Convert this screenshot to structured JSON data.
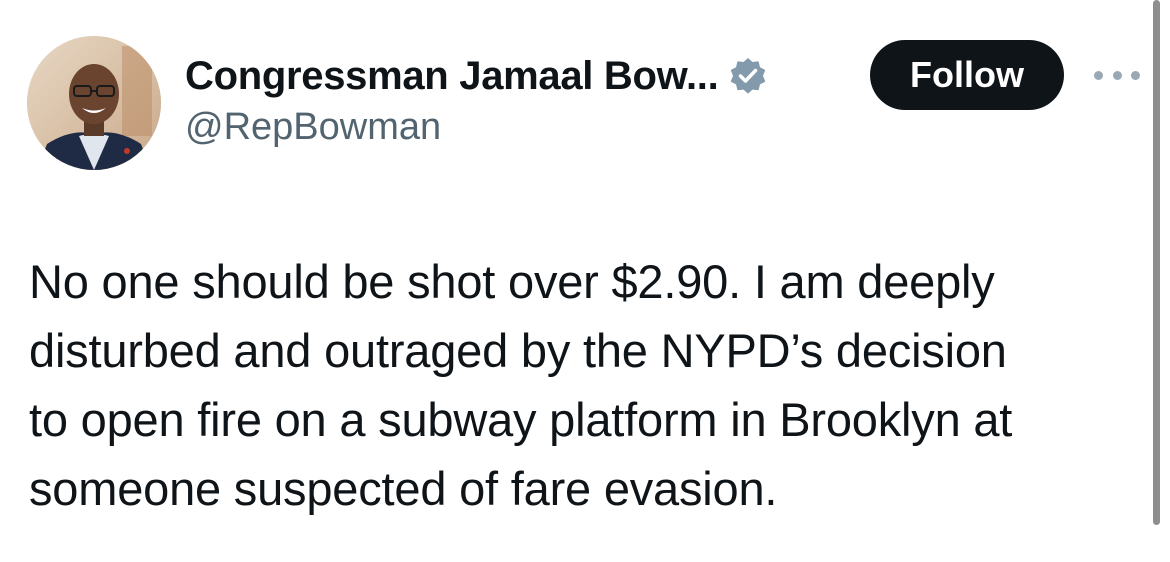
{
  "author": {
    "display_name": "Congressman Jamaal Bow...",
    "handle": "@RepBowman",
    "avatar_icon": "profile-photo",
    "verified_icon": "verified-badge-icon",
    "verified_color": "#829aab"
  },
  "actions": {
    "follow_label": "Follow",
    "more_icon": "more-options-icon"
  },
  "tweet": {
    "lines": [
      "No one should be shot over $2.90. I am deeply",
      "disturbed and outraged by the NYPD’s decision",
      "to open fire on a subway platform in Brooklyn at",
      "someone suspected of fare evasion."
    ]
  },
  "colors": {
    "text": "#0f1419",
    "secondary": "#536471",
    "button_bg": "#0f1419",
    "button_text": "#ffffff"
  }
}
